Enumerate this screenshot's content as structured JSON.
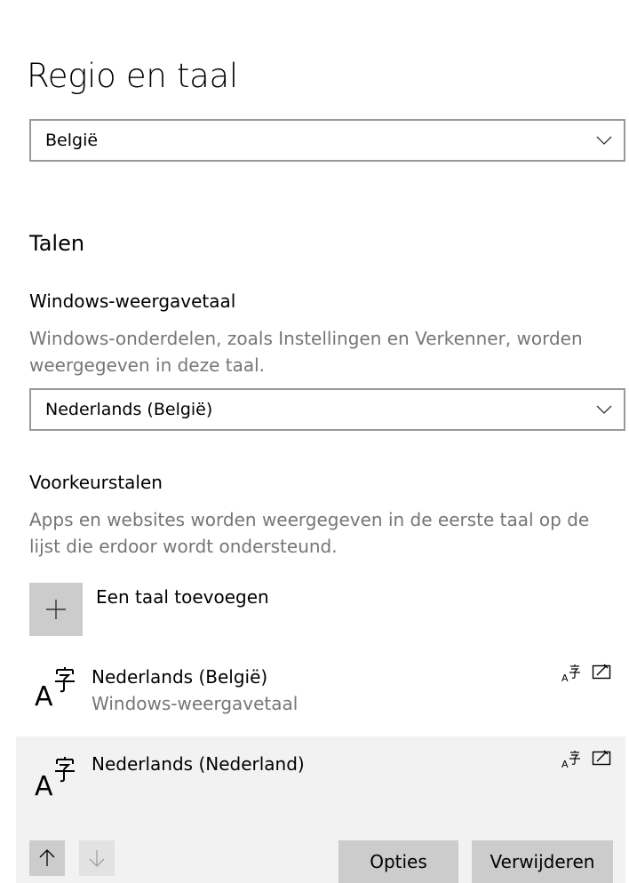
{
  "page": {
    "title": "Regio en taal"
  },
  "region": {
    "selected": "België"
  },
  "languages": {
    "section_title": "Talen",
    "display_language": {
      "label": "Windows-weergavetaal",
      "description": "Windows-onderdelen, zoals Instellingen en Verkenner, worden weergegeven in deze taal.",
      "selected": "Nederlands (België)"
    },
    "preferred": {
      "label": "Voorkeurstalen",
      "description": "Apps en websites worden weergegeven in de eerste taal op de lijst die erdoor wordt ondersteund.",
      "add_label": "Een taal toevoegen",
      "items": [
        {
          "name": "Nederlands (België)",
          "subtitle": "Windows-weergavetaal",
          "selected": false,
          "features": [
            "language-pack-icon",
            "handwriting-icon"
          ]
        },
        {
          "name": "Nederlands (Nederland)",
          "subtitle": "",
          "selected": true,
          "features": [
            "language-pack-icon",
            "handwriting-icon"
          ]
        }
      ],
      "options_label": "Opties",
      "remove_label": "Verwijderen"
    }
  },
  "colors": {
    "secondary_text": "#767676",
    "button_bg": "#cccccc",
    "selected_row_bg": "#f2f2f2",
    "border": "#999999"
  }
}
